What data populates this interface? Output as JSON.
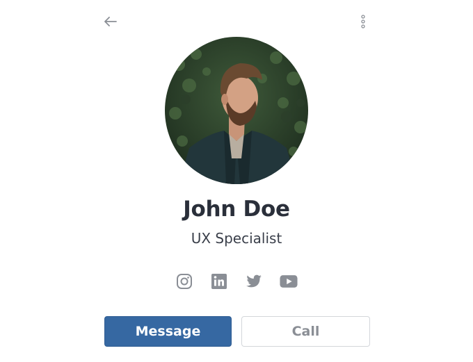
{
  "header": {
    "back_icon": "arrow-left-icon",
    "more_icon": "more-vertical-icon"
  },
  "profile": {
    "name": "John Doe",
    "role": "UX Specialist",
    "avatar_alt": "Profile photo"
  },
  "socials": [
    {
      "icon": "instagram-icon"
    },
    {
      "icon": "linkedin-icon"
    },
    {
      "icon": "twitter-icon"
    },
    {
      "icon": "youtube-icon"
    }
  ],
  "actions": {
    "message_label": "Message",
    "call_label": "Call"
  },
  "colors": {
    "primary": "#3668a2",
    "text_dark": "#2a2f3a",
    "icon_gray": "#8a8e95",
    "border_gray": "#d3d6da"
  }
}
